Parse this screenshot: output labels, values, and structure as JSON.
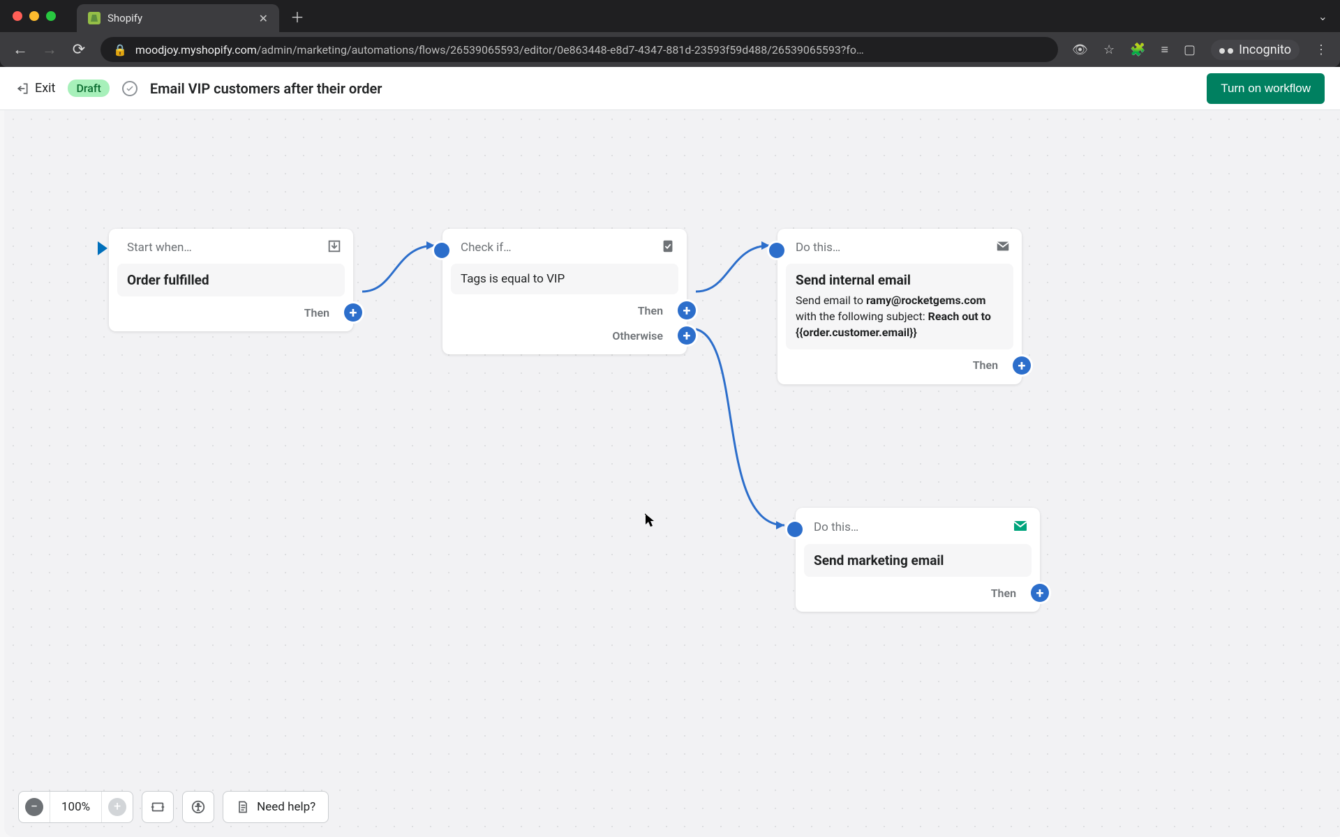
{
  "browser": {
    "tab_title": "Shopify",
    "url_host": "moodjoy.myshopify.com",
    "url_path": "/admin/marketing/automations/flows/26539065593/editor/0e863448-e8d7-4347-881d-23593f59d488/26539065593?fo…",
    "incognito_label": "Incognito"
  },
  "header": {
    "exit_label": "Exit",
    "status": "Draft",
    "title": "Email VIP customers after their order",
    "primary_button": "Turn on workflow"
  },
  "nodes": {
    "trigger": {
      "header": "Start when…",
      "body": "Order fulfilled",
      "out_then": "Then"
    },
    "condition": {
      "header": "Check if…",
      "body": "Tags is equal to VIP",
      "out_then": "Then",
      "out_otherwise": "Otherwise"
    },
    "action_email": {
      "header": "Do this…",
      "title": "Send internal email",
      "desc_prefix": "Send email to ",
      "desc_recipient": "ramy@rocketgems.com",
      "desc_mid": " with the following subject: ",
      "desc_subject": "Reach out to {{order.customer.email}}",
      "out_then": "Then"
    },
    "action_marketing": {
      "header": "Do this…",
      "title": "Send marketing email",
      "out_then": "Then"
    }
  },
  "bottom": {
    "zoom": "100%",
    "help_label": "Need help?"
  }
}
